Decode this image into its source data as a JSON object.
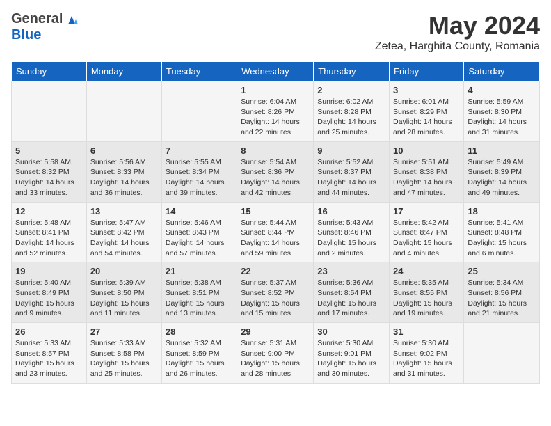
{
  "header": {
    "logo_line1": "General",
    "logo_line2": "Blue",
    "main_title": "May 2024",
    "subtitle": "Zetea, Harghita County, Romania"
  },
  "days_of_week": [
    "Sunday",
    "Monday",
    "Tuesday",
    "Wednesday",
    "Thursday",
    "Friday",
    "Saturday"
  ],
  "weeks": [
    [
      {
        "day": "",
        "info": ""
      },
      {
        "day": "",
        "info": ""
      },
      {
        "day": "",
        "info": ""
      },
      {
        "day": "1",
        "info": "Sunrise: 6:04 AM\nSunset: 8:26 PM\nDaylight: 14 hours\nand 22 minutes."
      },
      {
        "day": "2",
        "info": "Sunrise: 6:02 AM\nSunset: 8:28 PM\nDaylight: 14 hours\nand 25 minutes."
      },
      {
        "day": "3",
        "info": "Sunrise: 6:01 AM\nSunset: 8:29 PM\nDaylight: 14 hours\nand 28 minutes."
      },
      {
        "day": "4",
        "info": "Sunrise: 5:59 AM\nSunset: 8:30 PM\nDaylight: 14 hours\nand 31 minutes."
      }
    ],
    [
      {
        "day": "5",
        "info": "Sunrise: 5:58 AM\nSunset: 8:32 PM\nDaylight: 14 hours\nand 33 minutes."
      },
      {
        "day": "6",
        "info": "Sunrise: 5:56 AM\nSunset: 8:33 PM\nDaylight: 14 hours\nand 36 minutes."
      },
      {
        "day": "7",
        "info": "Sunrise: 5:55 AM\nSunset: 8:34 PM\nDaylight: 14 hours\nand 39 minutes."
      },
      {
        "day": "8",
        "info": "Sunrise: 5:54 AM\nSunset: 8:36 PM\nDaylight: 14 hours\nand 42 minutes."
      },
      {
        "day": "9",
        "info": "Sunrise: 5:52 AM\nSunset: 8:37 PM\nDaylight: 14 hours\nand 44 minutes."
      },
      {
        "day": "10",
        "info": "Sunrise: 5:51 AM\nSunset: 8:38 PM\nDaylight: 14 hours\nand 47 minutes."
      },
      {
        "day": "11",
        "info": "Sunrise: 5:49 AM\nSunset: 8:39 PM\nDaylight: 14 hours\nand 49 minutes."
      }
    ],
    [
      {
        "day": "12",
        "info": "Sunrise: 5:48 AM\nSunset: 8:41 PM\nDaylight: 14 hours\nand 52 minutes."
      },
      {
        "day": "13",
        "info": "Sunrise: 5:47 AM\nSunset: 8:42 PM\nDaylight: 14 hours\nand 54 minutes."
      },
      {
        "day": "14",
        "info": "Sunrise: 5:46 AM\nSunset: 8:43 PM\nDaylight: 14 hours\nand 57 minutes."
      },
      {
        "day": "15",
        "info": "Sunrise: 5:44 AM\nSunset: 8:44 PM\nDaylight: 14 hours\nand 59 minutes."
      },
      {
        "day": "16",
        "info": "Sunrise: 5:43 AM\nSunset: 8:46 PM\nDaylight: 15 hours\nand 2 minutes."
      },
      {
        "day": "17",
        "info": "Sunrise: 5:42 AM\nSunset: 8:47 PM\nDaylight: 15 hours\nand 4 minutes."
      },
      {
        "day": "18",
        "info": "Sunrise: 5:41 AM\nSunset: 8:48 PM\nDaylight: 15 hours\nand 6 minutes."
      }
    ],
    [
      {
        "day": "19",
        "info": "Sunrise: 5:40 AM\nSunset: 8:49 PM\nDaylight: 15 hours\nand 9 minutes."
      },
      {
        "day": "20",
        "info": "Sunrise: 5:39 AM\nSunset: 8:50 PM\nDaylight: 15 hours\nand 11 minutes."
      },
      {
        "day": "21",
        "info": "Sunrise: 5:38 AM\nSunset: 8:51 PM\nDaylight: 15 hours\nand 13 minutes."
      },
      {
        "day": "22",
        "info": "Sunrise: 5:37 AM\nSunset: 8:52 PM\nDaylight: 15 hours\nand 15 minutes."
      },
      {
        "day": "23",
        "info": "Sunrise: 5:36 AM\nSunset: 8:54 PM\nDaylight: 15 hours\nand 17 minutes."
      },
      {
        "day": "24",
        "info": "Sunrise: 5:35 AM\nSunset: 8:55 PM\nDaylight: 15 hours\nand 19 minutes."
      },
      {
        "day": "25",
        "info": "Sunrise: 5:34 AM\nSunset: 8:56 PM\nDaylight: 15 hours\nand 21 minutes."
      }
    ],
    [
      {
        "day": "26",
        "info": "Sunrise: 5:33 AM\nSunset: 8:57 PM\nDaylight: 15 hours\nand 23 minutes."
      },
      {
        "day": "27",
        "info": "Sunrise: 5:33 AM\nSunset: 8:58 PM\nDaylight: 15 hours\nand 25 minutes."
      },
      {
        "day": "28",
        "info": "Sunrise: 5:32 AM\nSunset: 8:59 PM\nDaylight: 15 hours\nand 26 minutes."
      },
      {
        "day": "29",
        "info": "Sunrise: 5:31 AM\nSunset: 9:00 PM\nDaylight: 15 hours\nand 28 minutes."
      },
      {
        "day": "30",
        "info": "Sunrise: 5:30 AM\nSunset: 9:01 PM\nDaylight: 15 hours\nand 30 minutes."
      },
      {
        "day": "31",
        "info": "Sunrise: 5:30 AM\nSunset: 9:02 PM\nDaylight: 15 hours\nand 31 minutes."
      },
      {
        "day": "",
        "info": ""
      }
    ]
  ]
}
